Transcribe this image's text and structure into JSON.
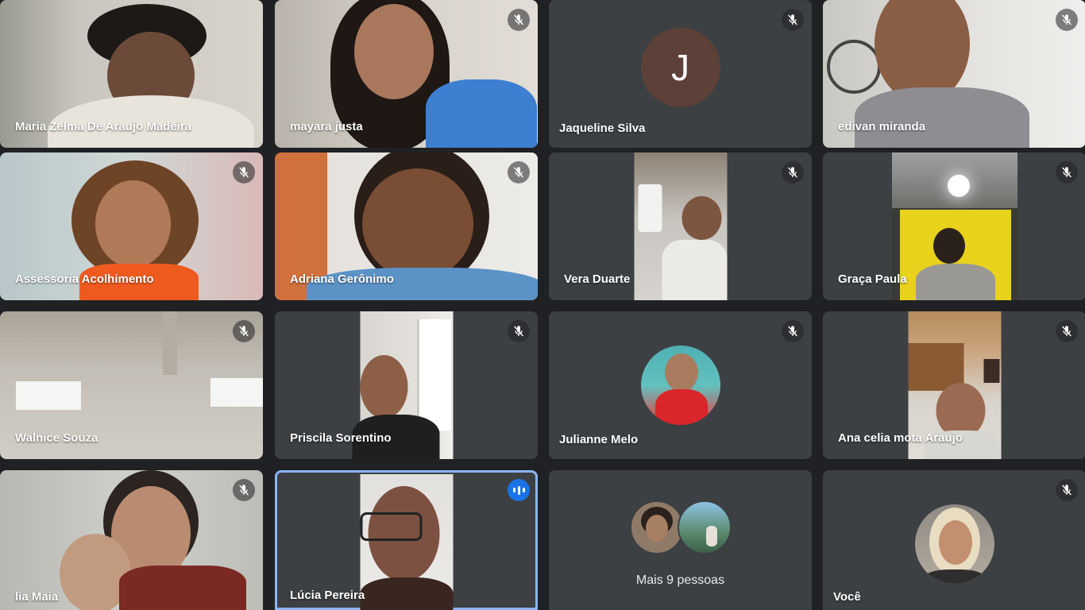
{
  "meeting": {
    "participants": [
      {
        "name": "Maria Zelma De Araujo Madeira",
        "muted": false
      },
      {
        "name": "mayara justa",
        "muted": true
      },
      {
        "name": "Jaqueline Silva",
        "muted": true,
        "initial": "J",
        "avatar_color": "#5d4037"
      },
      {
        "name": "edivan miranda",
        "muted": true
      },
      {
        "name": "Assessoria Acolhimento",
        "muted": true
      },
      {
        "name": "Adriana Gerônimo",
        "muted": true
      },
      {
        "name": "Vera Duarte",
        "muted": true
      },
      {
        "name": "Graça Paula",
        "muted": true
      },
      {
        "name": "Walnice Souza",
        "muted": true
      },
      {
        "name": "Priscila Sorentino",
        "muted": true
      },
      {
        "name": "Julianne Melo",
        "muted": true
      },
      {
        "name": "Ana celia mota Araujo",
        "muted": true
      },
      {
        "name": "lia Maia",
        "muted": true
      },
      {
        "name": "Lúcia Pereira",
        "muted": false,
        "speaking": true
      },
      {
        "more_label": "Mais 9 pessoas"
      },
      {
        "name": "Você",
        "muted": true
      }
    ],
    "icons": {
      "muted": "mic-off-icon",
      "speaking": "audio-level-icon"
    },
    "colors": {
      "background": "#202124",
      "tile": "#3c4043",
      "speaking_border": "#8ab4f8",
      "speaking_badge": "#1a73e8"
    }
  }
}
